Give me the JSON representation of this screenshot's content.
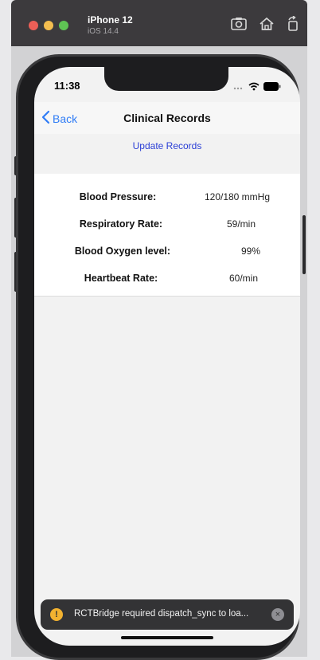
{
  "simulator": {
    "device_name": "iPhone 12",
    "os_version": "iOS 14.4",
    "toolbar_icons": [
      "screenshot-icon",
      "home-icon",
      "rotate-icon"
    ]
  },
  "status_bar": {
    "time": "11:38"
  },
  "nav": {
    "back_label": "Back",
    "title": "Clinical Records"
  },
  "update_link": "Update Records",
  "records": [
    {
      "label": "Blood Pressure:",
      "value": "120/180 mmHg"
    },
    {
      "label": "Respiratory Rate:",
      "value": "59/min"
    },
    {
      "label": "Blood Oxygen level:",
      "value": "99%"
    },
    {
      "label": "Heartbeat Rate:",
      "value": "60/min"
    }
  ],
  "toast": {
    "icon": "!",
    "message": "RCTBridge required dispatch_sync to loa...",
    "close": "×"
  },
  "colors": {
    "accent": "#2f7cf6",
    "link": "#2b3fd6",
    "toast_warning": "#f2b230"
  }
}
